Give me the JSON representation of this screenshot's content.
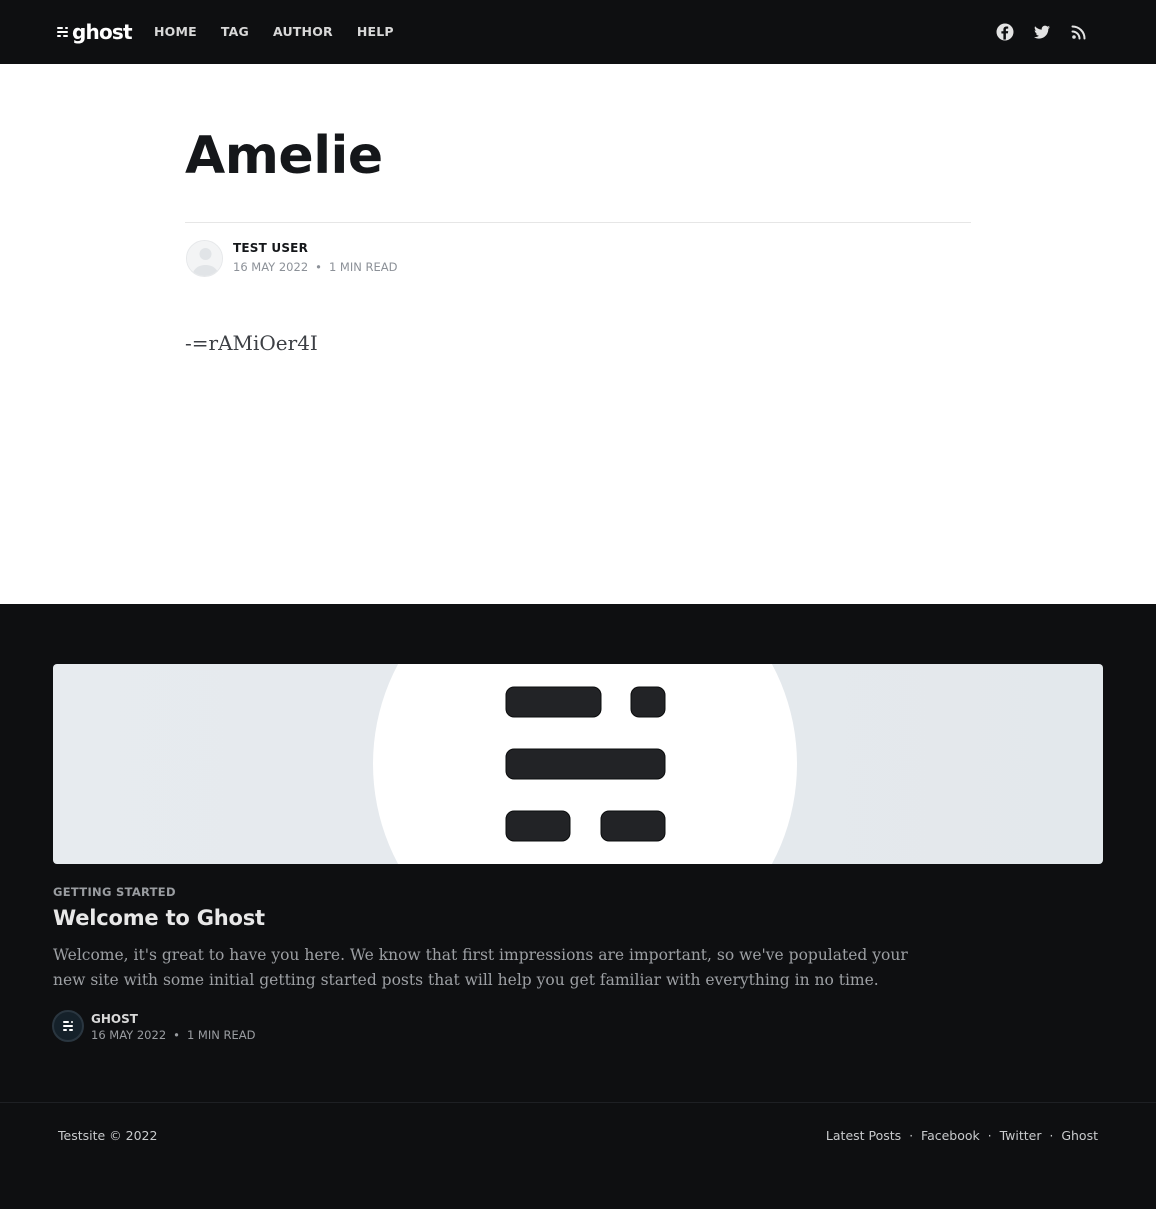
{
  "header": {
    "logo_text": "ghost",
    "nav": [
      "HOME",
      "TAG",
      "AUTHOR",
      "HELP"
    ],
    "social_icons": [
      "facebook-icon",
      "twitter-icon",
      "rss-icon"
    ]
  },
  "article": {
    "title": "Amelie",
    "author": "TEST USER",
    "date": "16 MAY 2022",
    "separator": "•",
    "read_time": "1 MIN READ",
    "content": "-=rAMiOer4I"
  },
  "feed": {
    "tag": "GETTING STARTED",
    "title": "Welcome to Ghost",
    "excerpt": "Welcome, it's great to have you here. We know that first impressions are important, so we've populated your new site with some initial getting started posts that will help you get familiar with everything in no time.",
    "author": "GHOST",
    "date": "16 MAY 2022",
    "separator": "•",
    "read_time": "1 MIN READ"
  },
  "footer": {
    "copyright": "Testsite © 2022",
    "links": [
      "Latest Posts",
      "Facebook",
      "Twitter",
      "Ghost"
    ],
    "separator": "·"
  },
  "colors": {
    "header_bg": "#0e0f11",
    "footer_bg": "#0e0f11",
    "title_text": "#15171a",
    "meta_text": "#8c9198"
  }
}
